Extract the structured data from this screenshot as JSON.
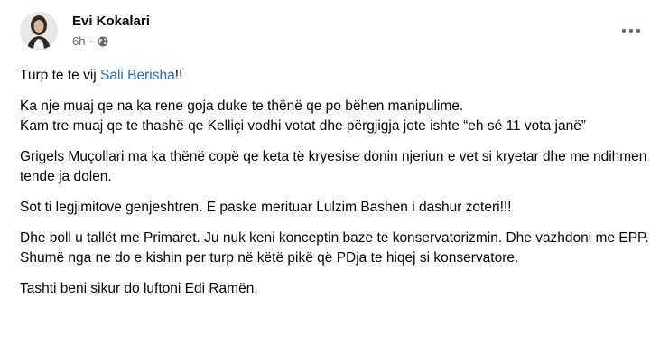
{
  "post": {
    "author": "Evi Kokalari",
    "time": "6h",
    "separator": "·",
    "audience_icon": "globe-icon",
    "menu_icon": "more-options-icon",
    "line1_prefix": "Turp te te vij ",
    "line1_mention": "Sali Berisha",
    "line1_suffix": "!!",
    "paragraphs": [
      "Ka nje muaj qe na ka rene goja duke te thënë qe po bëhen manipulime.\nKam tre muaj qe te thashë qe Kelliçi vodhi votat dhe përgjigja jote ishte “eh sé 11 vota janë”",
      "Grigels Muçollari ma ka thënë copë qe keta të kryesise donin njeriun e vet si kryetar dhe me ndihmen tende ja dolen.",
      "Sot ti legjimitove genjeshtren. E paske merituar Lulzim Bashen i dashur zoteri!!!",
      "Dhe boll u tallët me Primaret. Ju nuk keni konceptin baze te konservatorizmin. Dhe vazhdoni me EPP. Shumë nga ne do e kishin per turp në këtë pikë që PDja te hiqej si konservatore.",
      "Tashti beni sikur do luftoni Edi Ramën."
    ]
  },
  "colors": {
    "text": "#050505",
    "secondary": "#65676b",
    "link": "#216fdb"
  }
}
